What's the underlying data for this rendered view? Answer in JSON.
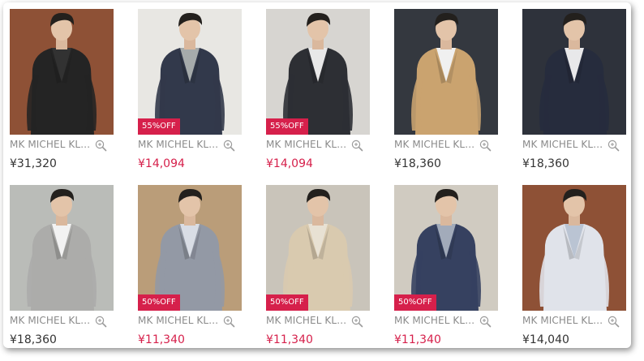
{
  "products": [
    {
      "brand": "MK MICHEL KL…",
      "price": "¥31,320",
      "sale": false,
      "badge": "",
      "bg": "#8a4a2e",
      "coat": "#1c1c1c",
      "shirt": "#2a2a2a",
      "pants": "#1a1a24"
    },
    {
      "brand": "MK MICHEL KL…",
      "price": "¥14,094",
      "sale": true,
      "badge": "55%OFF",
      "bg": "#e8e6e2",
      "coat": "#2a3144",
      "shirt": "#a3a8a8",
      "pants": "#2a2a2a"
    },
    {
      "brand": "MK MICHEL KL…",
      "price": "¥14,094",
      "sale": true,
      "badge": "55%OFF",
      "bg": "#d6d4d0",
      "coat": "#25272c",
      "shirt": "#e8e8e8",
      "pants": "#1a1a1a"
    },
    {
      "brand": "MK MICHEL KL…",
      "price": "¥18,360",
      "sale": false,
      "badge": "",
      "bg": "#2c3038",
      "coat": "#c8a06a",
      "shirt": "#f0f0f0",
      "pants": "#2a2a2a"
    },
    {
      "brand": "MK MICHEL KL…",
      "price": "¥18,360",
      "sale": false,
      "badge": "",
      "bg": "#262a33",
      "coat": "#1e2436",
      "shirt": "#e8e8ea",
      "pants": "#1a1a1a"
    },
    {
      "brand": "MK MICHEL KL…",
      "price": "¥18,360",
      "sale": false,
      "badge": "",
      "bg": "#b8bab6",
      "coat": "#a9a9a7",
      "shirt": "#f2f2f2",
      "pants": "#2a2a2a"
    },
    {
      "brand": "MK MICHEL KL…",
      "price": "¥11,340",
      "sale": true,
      "badge": "50%OFF",
      "bg": "#b89a74",
      "coat": "#8f95a2",
      "shirt": "#d8dce4",
      "pants": "#2a2a2a"
    },
    {
      "brand": "MK MICHEL KL…",
      "price": "¥11,340",
      "sale": true,
      "badge": "50%OFF",
      "bg": "#c7c2b8",
      "coat": "#d8c8ac",
      "shirt": "#e8e0d2",
      "pants": "#3a3a3a"
    },
    {
      "brand": "MK MICHEL KL…",
      "price": "¥11,340",
      "sale": true,
      "badge": "50%OFF",
      "bg": "#cfc9bf",
      "coat": "#2e3a5a",
      "shirt": "#9fa8b8",
      "pants": "#2a2a2a"
    },
    {
      "brand": "MK MICHEL KL…",
      "price": "¥14,040",
      "sale": false,
      "badge": "",
      "bg": "#8a4a2e",
      "coat": "#dfe2ea",
      "shirt": "#b8c2d2",
      "pants": "#303030"
    }
  ],
  "colors": {
    "sale": "#d6204b",
    "brand_text": "#8a8a8a",
    "price_text": "#333333"
  },
  "icons": {
    "zoom": "zoom-in-icon"
  }
}
